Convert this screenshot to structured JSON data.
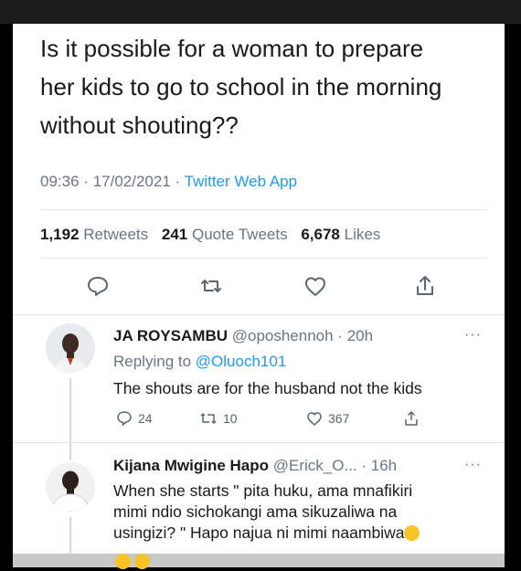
{
  "tweet": {
    "text_lines": [
      "Is it possible for a woman to prepare",
      "her kids to go to school in the morning",
      "without shouting??"
    ],
    "time": "09:36",
    "date": "17/02/2021",
    "source": "Twitter Web App",
    "dot": "·"
  },
  "stats": {
    "retweets_count": "1,192",
    "retweets_label": "Retweets",
    "quotes_count": "241",
    "quotes_label": "Quote Tweets",
    "likes_count": "6,678",
    "likes_label": "Likes"
  },
  "actions": {
    "icons": [
      "reply-icon",
      "retweet-icon",
      "like-icon",
      "share-icon"
    ],
    "accent": "#1d9bf0"
  },
  "reply1": {
    "name": "JA ROYSAMBU",
    "handle": "@oposhennoh",
    "time": "· 20h",
    "more": "···",
    "replying_prefix": "Replying to",
    "replying_handle": "@Oluoch101",
    "text": "The shouts are for the husband not the kids",
    "reply_count": "24",
    "retweet_count": "10",
    "like_count": "367"
  },
  "reply2": {
    "name": "Kijana Mwigine Hapo",
    "handle": "@Erick_O...",
    "time": "· 16h",
    "more": "···",
    "line1": "When she starts \" pita huku, ama mnafikiri",
    "line2": "mimi ndio sichokangi ama sikuzaliwa na",
    "line3": "usingizi? \" Hapo najua ni mimi naambiwa"
  }
}
